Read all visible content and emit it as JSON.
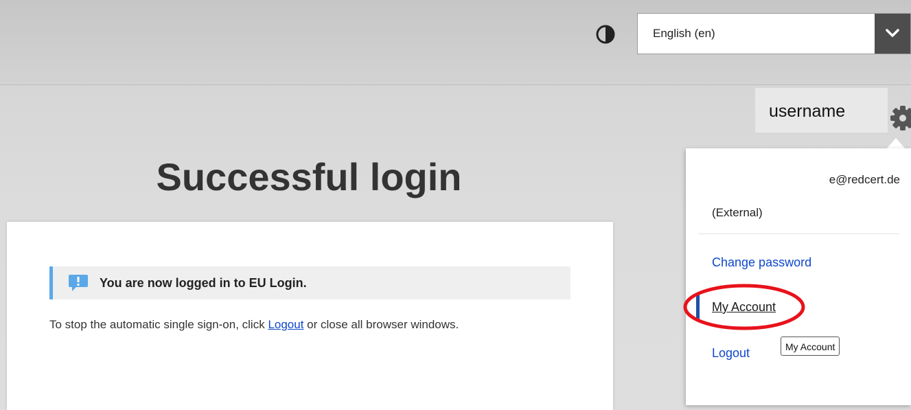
{
  "header": {
    "language": {
      "selected": "English (en)"
    }
  },
  "user": {
    "username": "username",
    "email_visible_part": "e@redcert.de",
    "account_type": "(External)"
  },
  "main": {
    "title": "Successful login",
    "alert": "You are now logged in to EU Login.",
    "sso_before": "To stop the automatic single sign-on, click ",
    "logout_link": "Logout",
    "sso_after": " or close all browser windows."
  },
  "dropdown": {
    "items": [
      {
        "label": "Change password"
      },
      {
        "label": "My Account"
      },
      {
        "label": "Logout"
      }
    ]
  },
  "tooltip": "My Account",
  "colors": {
    "link": "#0e47cb",
    "alert_border": "#5aa8e8",
    "highlight": "#e8121b",
    "select_toggle": "#4d4d4d",
    "active_marker": "#1f4fa8"
  },
  "icons": [
    "contrast-icon",
    "chevron-down-icon",
    "gear-icon",
    "info-icon"
  ]
}
